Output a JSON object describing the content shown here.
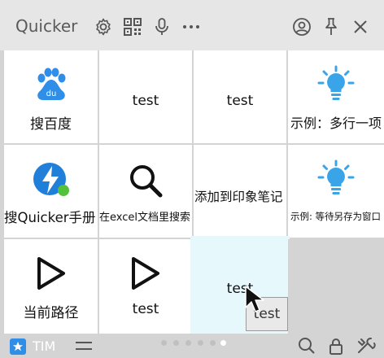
{
  "header": {
    "title": "Quicker"
  },
  "grid": {
    "rows": [
      [
        {
          "label": "搜百度",
          "icon": "baidu-icon"
        },
        {
          "label": "test",
          "icon": ""
        },
        {
          "label": "test",
          "icon": ""
        },
        {
          "label": "示例：多行一项",
          "icon": "lightbulb-icon"
        }
      ],
      [
        {
          "label": "搜Quicker手册",
          "icon": "quicker-bolt-icon"
        },
        {
          "label": "在excel文档里搜索",
          "icon": "magnifier-icon"
        },
        {
          "label": "添加到印象笔记",
          "icon": ""
        },
        {
          "label": "示例: 等待另存为窗口",
          "icon": "lightbulb-icon"
        }
      ],
      [
        {
          "label": "当前路径",
          "icon": "play-triangle-icon"
        },
        {
          "label": "test",
          "icon": "play-triangle-icon"
        },
        {
          "label": "test",
          "icon": ""
        },
        {
          "label": "",
          "icon": ""
        }
      ]
    ]
  },
  "drag": {
    "label": "test"
  },
  "footer": {
    "app_label": "TIM",
    "pages": 6,
    "active_page": 5
  },
  "colors": {
    "accent": "#2f8ee8",
    "bulb": "#3aa4e8",
    "hover_cell": "#e6f8fc",
    "header_bg": "#e6e6e6"
  }
}
